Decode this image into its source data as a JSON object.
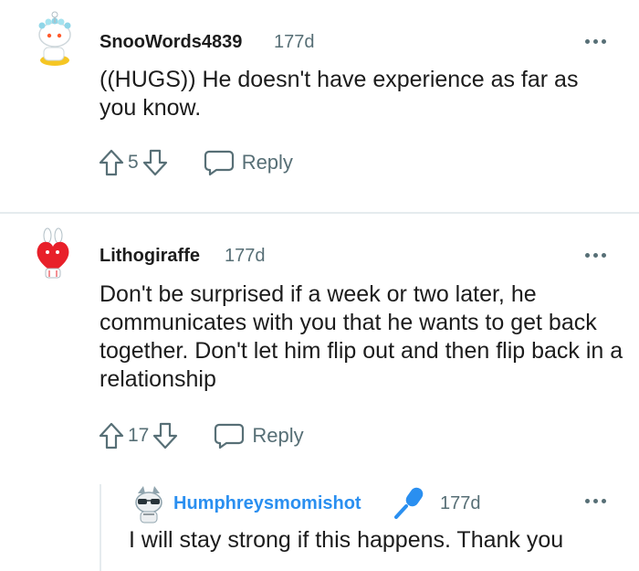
{
  "comments": [
    {
      "username": "SnooWords4839",
      "age": "177d",
      "body": "((HUGS)) He doesn't have experience as far as you know.",
      "score": "5",
      "reply_label": "Reply",
      "avatar": "snoo-avatar-flower-crown-duck-float"
    },
    {
      "username": "Lithogiraffe",
      "age": "177d",
      "body": "Don't be surprised if a week or two later, he communicates with you that he wants to get back together. Don't let him flip out and then flip back in a relationship",
      "score": "17",
      "reply_label": "Reply",
      "avatar": "snoo-avatar-red-heart-bunny"
    }
  ],
  "reply": {
    "username": "Humphreysmomishot",
    "op_badge_icon": "microphone-icon",
    "age": "177d",
    "body": "I will stay strong if this happens. Thank you",
    "avatar": "snoo-avatar-sunglasses"
  },
  "colors": {
    "meta_gray": "#576f76",
    "op_blue": "#2a8ff0",
    "divider": "#e5ebee"
  }
}
